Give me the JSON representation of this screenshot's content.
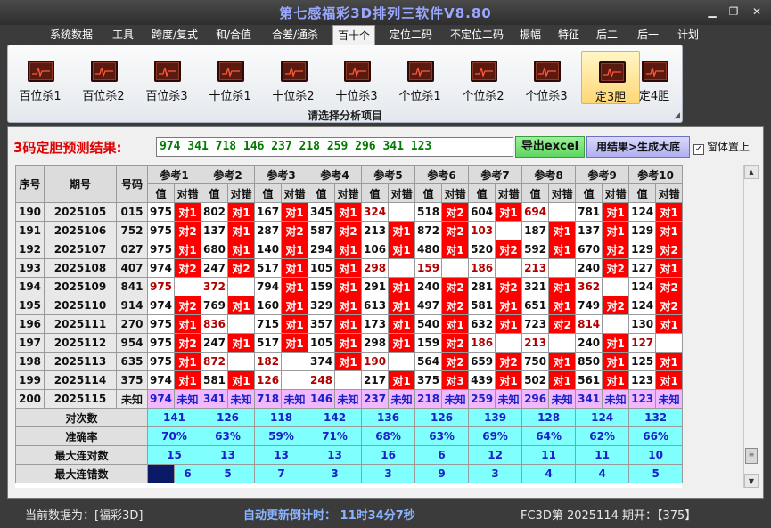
{
  "window": {
    "title": "第七感福彩3D排列三软件V8.80"
  },
  "menu": [
    "系统数据",
    "工具",
    "跨度/复式",
    "和/合值",
    "合差/通杀",
    "百十个",
    "定位二码",
    "不定位二码",
    "振幅",
    "特征",
    "后二",
    "后一",
    "计划"
  ],
  "menu_active_index": 5,
  "ribbon": {
    "buttons": [
      "百位杀1",
      "百位杀2",
      "百位杀3",
      "十位杀1",
      "十位杀2",
      "十位杀3",
      "个位杀1",
      "个位杀2",
      "个位杀3",
      "定3胆",
      "定4胆"
    ],
    "selected_index": 9,
    "caption": "请选择分析项目"
  },
  "result": {
    "label": "3码定胆预测结果:",
    "value": "974 341 718 146 237 218 259 296 341 123",
    "export_label": "导出excel",
    "generate_label": "用结果>生成大底",
    "topmost_label": "窗体置上",
    "topmost_checked": "✓"
  },
  "grid": {
    "head_fixed": [
      "序号",
      "期号",
      "号码"
    ],
    "groups": [
      "参考1",
      "参考2",
      "参考3",
      "参考4",
      "参考5",
      "参考6",
      "参考7",
      "参考8",
      "参考9",
      "参考10"
    ],
    "subhead": [
      "值",
      "对错"
    ],
    "rows": [
      {
        "seq": "190",
        "issue": "2025105",
        "num": "015",
        "cells": [
          [
            "975",
            "对1",
            0
          ],
          [
            "802",
            "对1",
            0
          ],
          [
            "167",
            "对1",
            0
          ],
          [
            "345",
            "对1",
            0
          ],
          [
            "324",
            "",
            1
          ],
          [
            "518",
            "对2",
            0
          ],
          [
            "604",
            "对1",
            0
          ],
          [
            "694",
            "",
            1
          ],
          [
            "781",
            "对1",
            0
          ],
          [
            "124",
            "对1",
            0
          ]
        ]
      },
      {
        "seq": "191",
        "issue": "2025106",
        "num": "752",
        "cells": [
          [
            "975",
            "对2",
            0
          ],
          [
            "137",
            "对1",
            0
          ],
          [
            "287",
            "对2",
            0
          ],
          [
            "587",
            "对2",
            0
          ],
          [
            "213",
            "对1",
            0
          ],
          [
            "872",
            "对2",
            0
          ],
          [
            "103",
            "",
            1
          ],
          [
            "187",
            "对1",
            0
          ],
          [
            "137",
            "对1",
            0
          ],
          [
            "129",
            "对1",
            0
          ]
        ]
      },
      {
        "seq": "192",
        "issue": "2025107",
        "num": "027",
        "cells": [
          [
            "975",
            "对1",
            0
          ],
          [
            "680",
            "对1",
            0
          ],
          [
            "140",
            "对1",
            0
          ],
          [
            "294",
            "对1",
            0
          ],
          [
            "106",
            "对1",
            0
          ],
          [
            "480",
            "对1",
            0
          ],
          [
            "520",
            "对2",
            0
          ],
          [
            "592",
            "对1",
            0
          ],
          [
            "670",
            "对2",
            0
          ],
          [
            "129",
            "对2",
            0
          ]
        ]
      },
      {
        "seq": "193",
        "issue": "2025108",
        "num": "407",
        "cells": [
          [
            "974",
            "对2",
            0
          ],
          [
            "247",
            "对2",
            0
          ],
          [
            "517",
            "对1",
            0
          ],
          [
            "105",
            "对1",
            0
          ],
          [
            "298",
            "",
            1
          ],
          [
            "159",
            "",
            1
          ],
          [
            "186",
            "",
            1
          ],
          [
            "213",
            "",
            1
          ],
          [
            "240",
            "对2",
            0
          ],
          [
            "127",
            "对1",
            0
          ]
        ]
      },
      {
        "seq": "194",
        "issue": "2025109",
        "num": "841",
        "cells": [
          [
            "975",
            "",
            1
          ],
          [
            "372",
            "",
            1
          ],
          [
            "794",
            "对1",
            0
          ],
          [
            "159",
            "对1",
            0
          ],
          [
            "291",
            "对1",
            0
          ],
          [
            "240",
            "对2",
            0
          ],
          [
            "281",
            "对2",
            0
          ],
          [
            "321",
            "对1",
            0
          ],
          [
            "362",
            "",
            1
          ],
          [
            "124",
            "对2",
            0
          ]
        ]
      },
      {
        "seq": "195",
        "issue": "2025110",
        "num": "914",
        "cells": [
          [
            "974",
            "对2",
            0
          ],
          [
            "769",
            "对1",
            0
          ],
          [
            "160",
            "对1",
            0
          ],
          [
            "329",
            "对1",
            0
          ],
          [
            "613",
            "对1",
            0
          ],
          [
            "497",
            "对2",
            0
          ],
          [
            "581",
            "对1",
            0
          ],
          [
            "651",
            "对1",
            0
          ],
          [
            "749",
            "对2",
            0
          ],
          [
            "124",
            "对2",
            0
          ]
        ]
      },
      {
        "seq": "196",
        "issue": "2025111",
        "num": "270",
        "cells": [
          [
            "975",
            "对1",
            0
          ],
          [
            "836",
            "",
            1
          ],
          [
            "715",
            "对1",
            0
          ],
          [
            "357",
            "对1",
            0
          ],
          [
            "173",
            "对1",
            0
          ],
          [
            "540",
            "对1",
            0
          ],
          [
            "632",
            "对1",
            0
          ],
          [
            "723",
            "对2",
            0
          ],
          [
            "814",
            "",
            1
          ],
          [
            "130",
            "对1",
            0
          ]
        ]
      },
      {
        "seq": "197",
        "issue": "2025112",
        "num": "954",
        "cells": [
          [
            "975",
            "对2",
            0
          ],
          [
            "247",
            "对1",
            0
          ],
          [
            "517",
            "对1",
            0
          ],
          [
            "105",
            "对1",
            0
          ],
          [
            "298",
            "对1",
            0
          ],
          [
            "159",
            "对2",
            0
          ],
          [
            "186",
            "",
            1
          ],
          [
            "213",
            "",
            1
          ],
          [
            "240",
            "对1",
            0
          ],
          [
            "127",
            "",
            1
          ]
        ]
      },
      {
        "seq": "198",
        "issue": "2025113",
        "num": "635",
        "cells": [
          [
            "975",
            "对1",
            0
          ],
          [
            "872",
            "",
            1
          ],
          [
            "182",
            "",
            1
          ],
          [
            "374",
            "对1",
            0
          ],
          [
            "190",
            "",
            1
          ],
          [
            "564",
            "对2",
            0
          ],
          [
            "659",
            "对2",
            0
          ],
          [
            "750",
            "对1",
            0
          ],
          [
            "850",
            "对1",
            0
          ],
          [
            "125",
            "对1",
            0
          ]
        ]
      },
      {
        "seq": "199",
        "issue": "2025114",
        "num": "375",
        "cells": [
          [
            "974",
            "对1",
            0
          ],
          [
            "581",
            "对1",
            0
          ],
          [
            "126",
            "",
            1
          ],
          [
            "248",
            "",
            1
          ],
          [
            "217",
            "对1",
            0
          ],
          [
            "375",
            "对3",
            0
          ],
          [
            "439",
            "对1",
            0
          ],
          [
            "502",
            "对1",
            0
          ],
          [
            "561",
            "对1",
            0
          ],
          [
            "123",
            "对1",
            0
          ]
        ]
      }
    ],
    "current": {
      "seq": "200",
      "issue": "2025115",
      "num": "未知",
      "cells": [
        [
          "974",
          "未知"
        ],
        [
          "341",
          "未知"
        ],
        [
          "718",
          "未知"
        ],
        [
          "146",
          "未知"
        ],
        [
          "237",
          "未知"
        ],
        [
          "218",
          "未知"
        ],
        [
          "259",
          "未知"
        ],
        [
          "296",
          "未知"
        ],
        [
          "341",
          "未知"
        ],
        [
          "123",
          "未知"
        ]
      ]
    },
    "stats": [
      {
        "label": "对次数",
        "values": [
          "141",
          "126",
          "118",
          "142",
          "136",
          "126",
          "139",
          "128",
          "124",
          "132"
        ]
      },
      {
        "label": "准确率",
        "values": [
          "70%",
          "63%",
          "59%",
          "71%",
          "68%",
          "63%",
          "69%",
          "64%",
          "62%",
          "66%"
        ]
      },
      {
        "label": "最大连对数",
        "values": [
          "15",
          "13",
          "13",
          "13",
          "16",
          "6",
          "12",
          "11",
          "11",
          "10"
        ]
      },
      {
        "label": "最大连错数",
        "values": [
          "6",
          "5",
          "7",
          "3",
          "3",
          "9",
          "3",
          "4",
          "4",
          "5"
        ]
      }
    ]
  },
  "status": {
    "left": "当前数据为：[福彩3D]",
    "mid": "自动更新倒计时：  11时34分7秒",
    "right": "FC3D第 2025114 期开：【375】"
  },
  "colors": {
    "hit": "#ff0000",
    "stats_bg": "#80ffff",
    "current_row_bg": "#f2b8ff",
    "title": "#9aa8ff"
  }
}
